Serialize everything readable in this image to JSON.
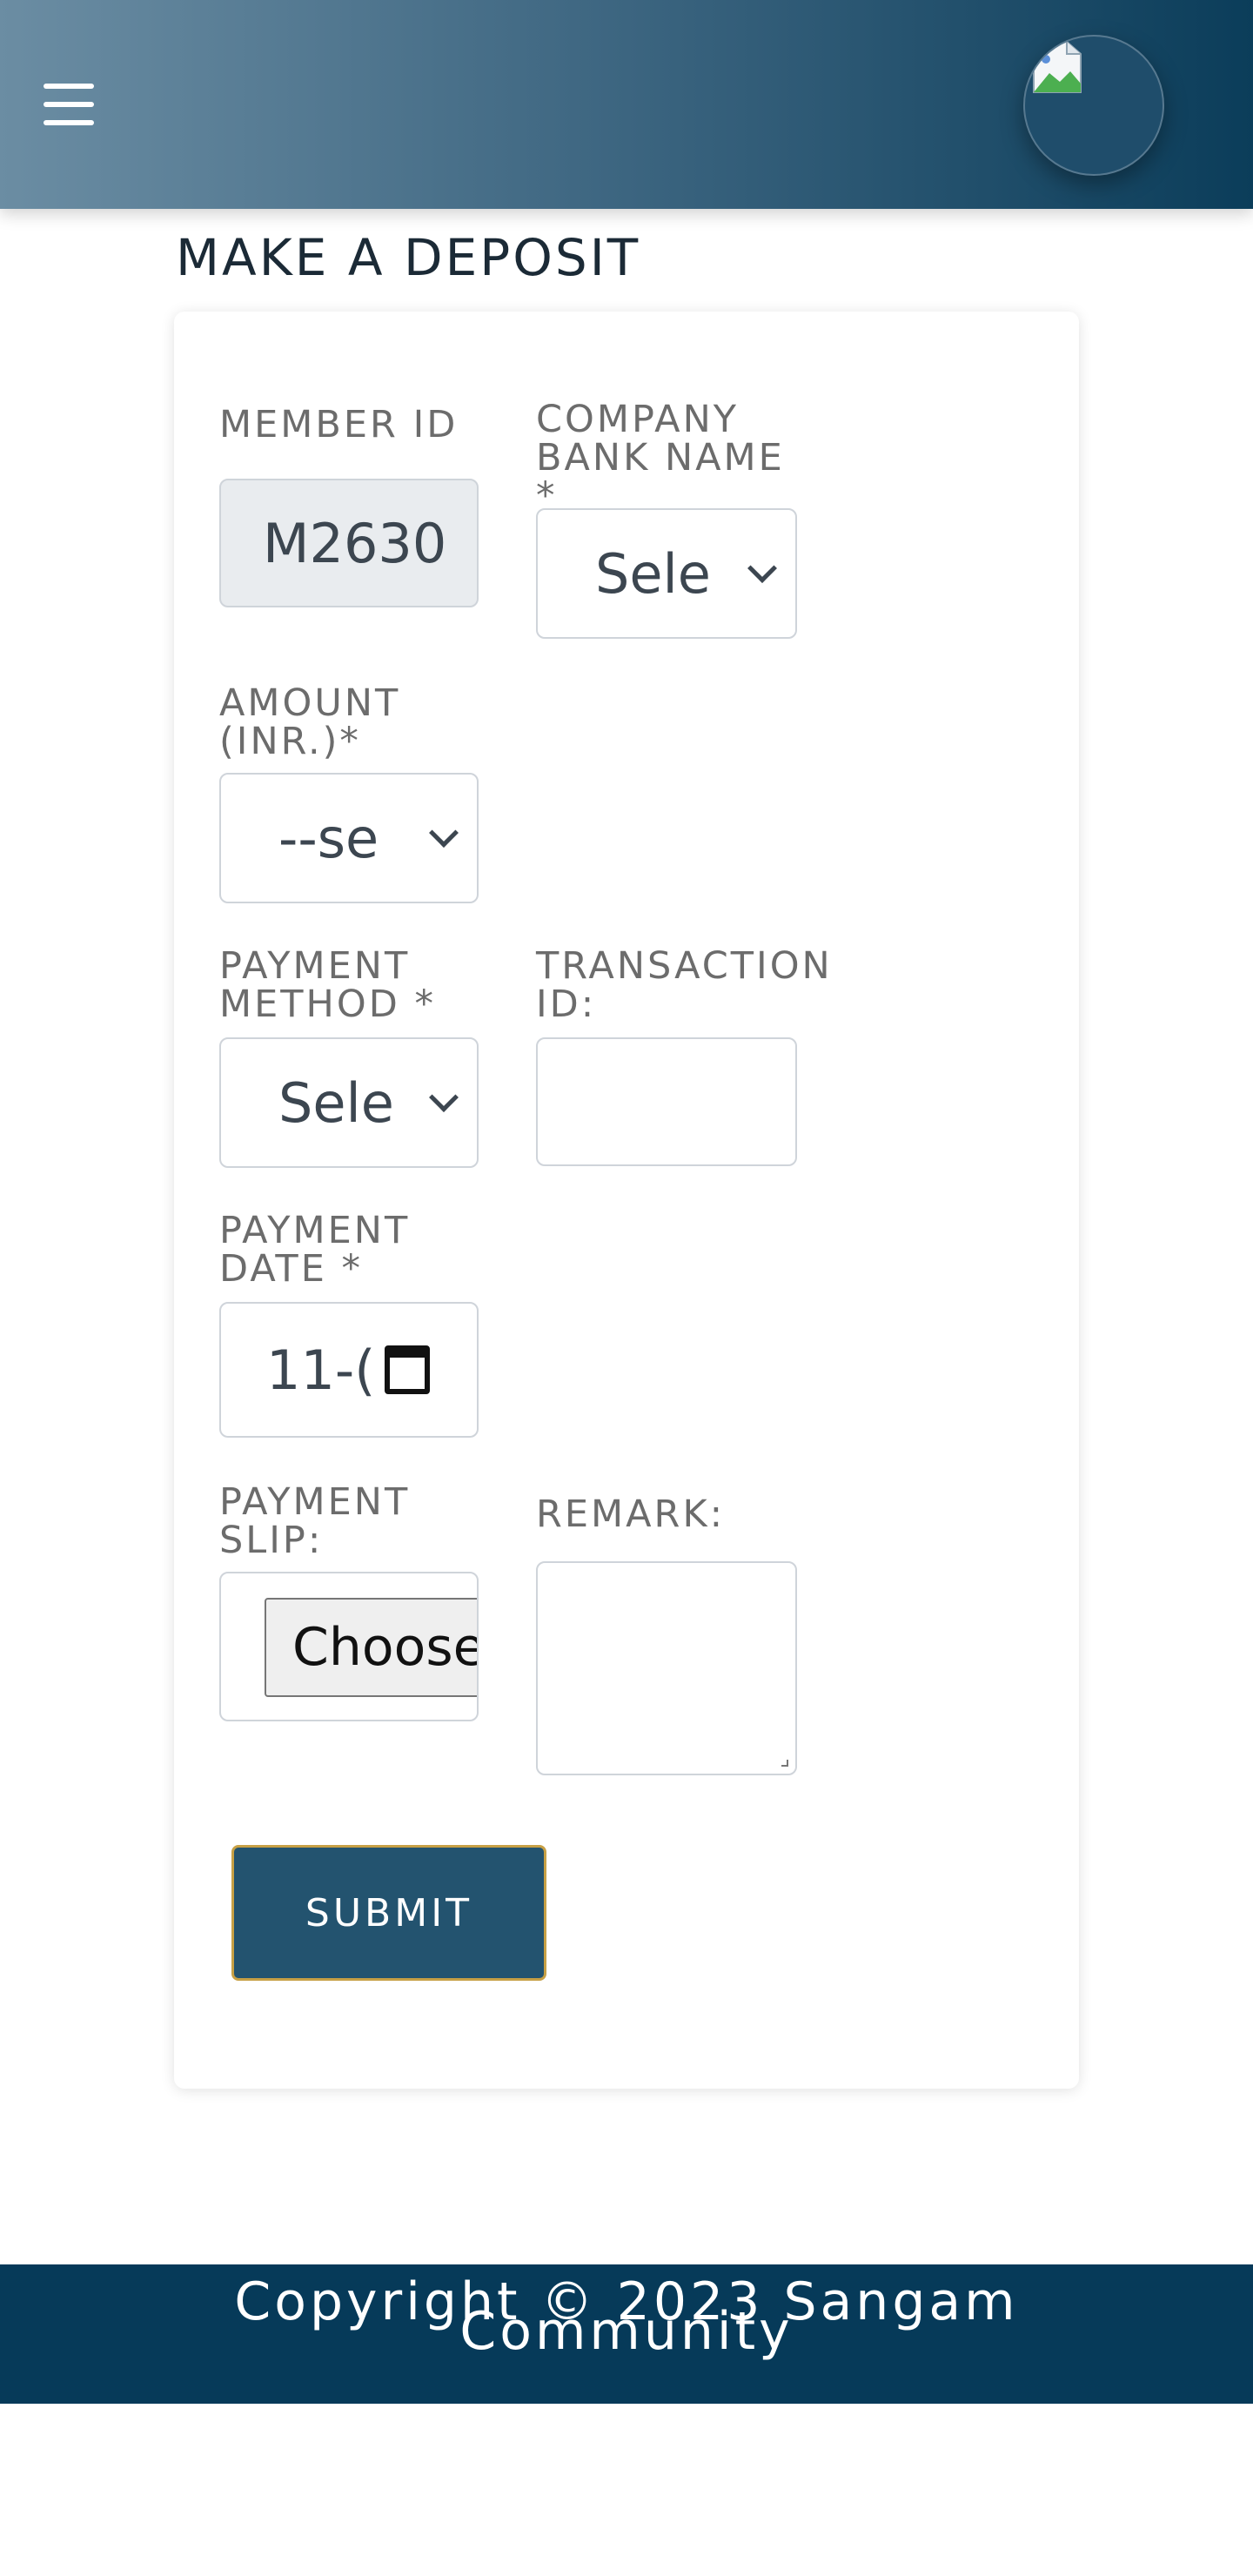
{
  "header": {
    "menu_icon": "hamburger-menu-icon",
    "avatar_icon": "broken-image-avatar-icon"
  },
  "page": {
    "title": "MAKE A DEPOSIT"
  },
  "form": {
    "member_id": {
      "label": "MEMBER ID",
      "value": "M2630"
    },
    "company_bank": {
      "label": "COMPANY BANK NAME *",
      "selected": "Sele"
    },
    "amount": {
      "label": "AMOUNT (INR.)*",
      "selected": "--se"
    },
    "payment_method": {
      "label": "PAYMENT METHOD *",
      "selected": "Sele"
    },
    "transaction_id": {
      "label": "TRANSACTION ID:",
      "value": ""
    },
    "payment_date": {
      "label": "PAYMENT DATE *",
      "value": "11-("
    },
    "payment_slip": {
      "label": "PAYMENT SLIP:",
      "button_label": "Choose"
    },
    "remark": {
      "label": "REMARK:",
      "value": ""
    },
    "submit_label": "SUBMIT"
  },
  "footer": {
    "copyright": "Copyright © 2023 Sangam Community"
  },
  "colors": {
    "header_start": "#6b8da3",
    "header_end": "#0b3d5a",
    "submit_bg": "#23536f",
    "submit_border": "#c7a045",
    "footer_bg": "#063a59"
  }
}
